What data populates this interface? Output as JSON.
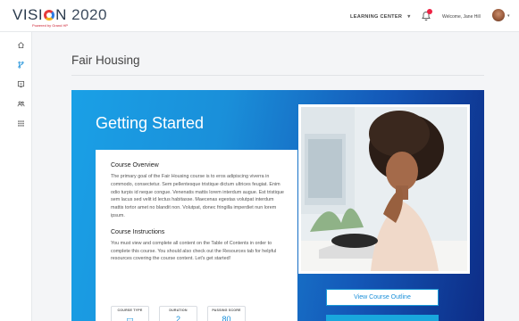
{
  "header": {
    "logo_text": "VISION 2020",
    "logo_sub": "Powered by Grand HP",
    "nav_learning_center": "LEARNING CENTER",
    "notification_count": "1",
    "welcome_text": "Welcome, Jane Hill"
  },
  "sidebar": {
    "items": [
      {
        "icon": "home-icon"
      },
      {
        "icon": "branch-icon"
      },
      {
        "icon": "certificate-icon"
      },
      {
        "icon": "users-icon"
      },
      {
        "icon": "grid-icon"
      }
    ]
  },
  "page": {
    "title": "Fair Housing"
  },
  "hero": {
    "title": "Getting Started"
  },
  "overview": {
    "heading": "Course Overview",
    "body": "The primary goal of the Fair Housing course is to eros adipiscing viverra in commodo, consectetur. Sem pellentesque tristique dictum ultrices feugiat. Enim odio turpis id neque congue. Venenatis mattis lorem interdum augue. Est tristique sem lacus sed velit id lectus habitasse. Maecenas egestas volutpat interdum mattis tortor amet no blandit non. Volutpat, donec fringilla imperdiet nun lorem ipsum.",
    "instructions_heading": "Course Instructions",
    "instructions_body": "You must view and complete all content on the Table of Contents in order to complete this course. You should also check out the Resources tab for helpful resources covering the course content. Let's get started!"
  },
  "stats": [
    {
      "label": "COURSE TYPE",
      "value": "▭"
    },
    {
      "label": "DURATION",
      "value": "2"
    },
    {
      "label": "PASSING SCORE",
      "value": "80"
    }
  ],
  "actions": {
    "view_outline": "View Course Outline"
  },
  "colors": {
    "accent": "#1a8fd9",
    "hero_start": "#1aa0e6",
    "hero_end": "#0d2c86"
  }
}
